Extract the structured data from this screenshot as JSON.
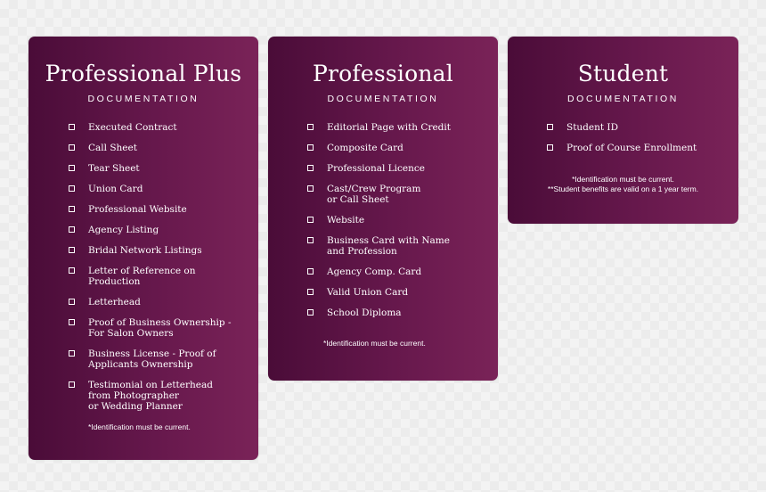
{
  "cards": {
    "professional_plus": {
      "title": "Professional Plus",
      "subtitle": "DOCUMENTATION",
      "items": [
        "Executed Contract",
        "Call Sheet",
        "Tear Sheet",
        "Union Card",
        "Professional Website",
        "Agency Listing",
        "Bridal Network Listings",
        "Letter of Reference on Production",
        "Letterhead",
        "Proof of Business Ownership -\nFor Salon Owners",
        "Business License - Proof of\nApplicants Ownership",
        "Testimonial on Letterhead\nfrom Photographer\nor Wedding Planner"
      ],
      "note": "*Identification must be current."
    },
    "professional": {
      "title": "Professional",
      "subtitle": "DOCUMENTATION",
      "items": [
        "Editorial Page with Credit",
        "Composite Card",
        "Professional Licence",
        "Cast/Crew Program\nor Call Sheet",
        "Website",
        "Business Card with Name\nand Profession",
        "Agency Comp. Card",
        "Valid Union Card",
        "School Diploma"
      ],
      "note": "*Identification must be current."
    },
    "student": {
      "title": "Student",
      "subtitle": "DOCUMENTATION",
      "items": [
        "Student ID",
        "Proof of Course Enrollment"
      ],
      "note": "*Identification must be current.\n**Student benefits are valid on a 1 year term."
    }
  }
}
